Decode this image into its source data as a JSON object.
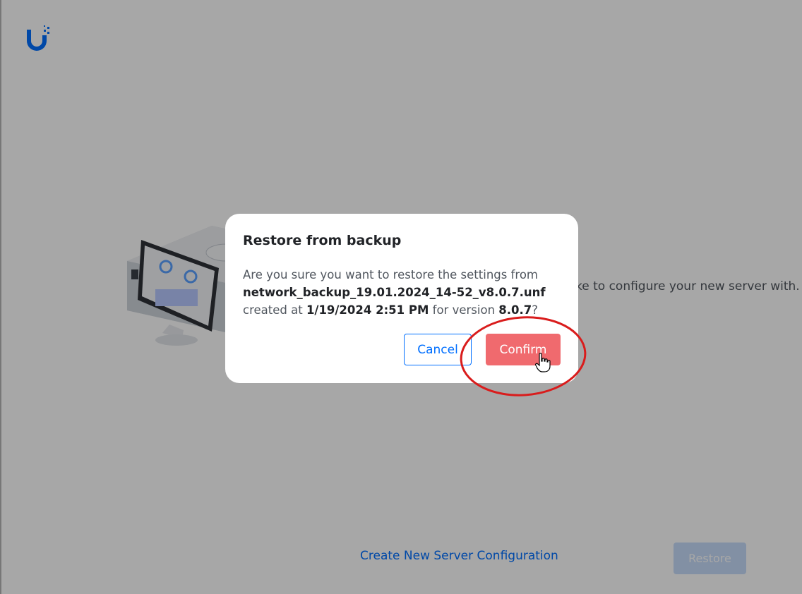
{
  "app": {
    "logo_icon": "ubiquiti-u-logo-icon",
    "brand_color": "#006fff"
  },
  "background": {
    "description_text_visible": "ke to configure your new server with.",
    "create_link": "Create New Server Configuration",
    "restore_button": "Restore"
  },
  "modal": {
    "title": "Restore from backup",
    "body_prefix": "Are you sure you want to restore the settings from",
    "filename": "network_backup_19.01.2024_14-52_v8.0.7.unf",
    "created_text": "created at",
    "created_datetime": "1/19/2024 2:51 PM",
    "for_version_text": "for version",
    "version": "8.0.7",
    "question_mark": "?",
    "cancel_label": "Cancel",
    "confirm_label": "Confirm",
    "confirm_color": "#f06a6e"
  },
  "annotation": {
    "highlight_icon": "red-ellipse-highlight",
    "cursor_icon": "hand-pointer-cursor-icon",
    "highlight_color": "#d91c1c"
  }
}
